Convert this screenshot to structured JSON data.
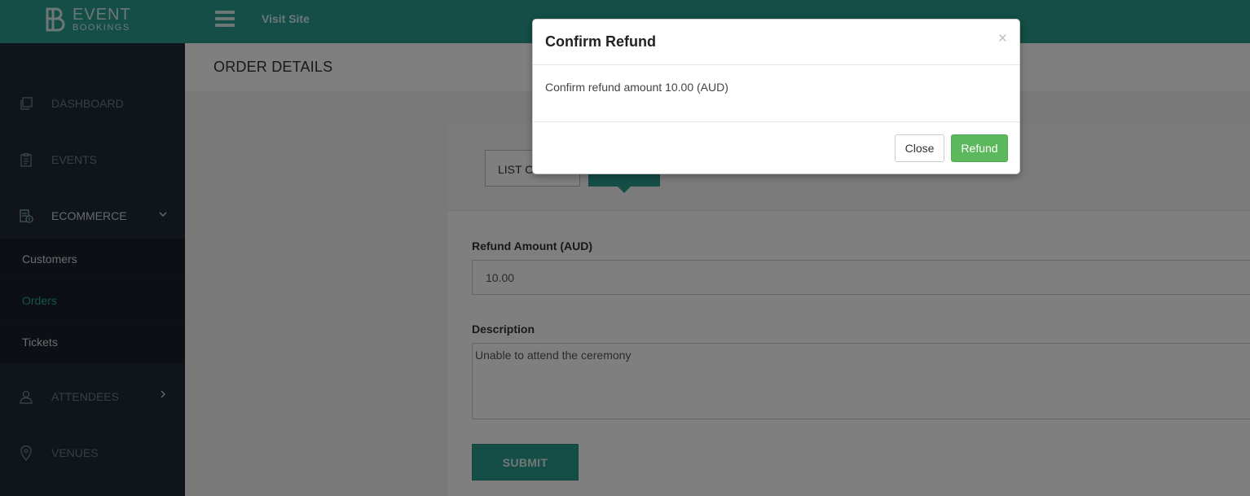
{
  "brand": {
    "line1": "EVENT",
    "line2": "BOOKINGS"
  },
  "topbar": {
    "visit_site": "Visit Site"
  },
  "sidebar": {
    "items": [
      {
        "label": "DASHBOARD",
        "icon": "copy-icon"
      },
      {
        "label": "EVENTS",
        "icon": "clipboard-icon"
      },
      {
        "label": "ECOMMERCE",
        "icon": "cash-register-icon"
      },
      {
        "label": "ATTENDEES",
        "icon": "user-icon"
      },
      {
        "label": "VENUES",
        "icon": "map-pin-icon"
      }
    ],
    "ecommerce_sub": [
      {
        "label": "Customers"
      },
      {
        "label": "Orders"
      },
      {
        "label": "Tickets"
      }
    ]
  },
  "page": {
    "title": "ORDER DETAILS"
  },
  "panel": {
    "list_button": "LIST ORDERS",
    "refund_amount_label": "Refund Amount (AUD)",
    "refund_amount_value": "10.00",
    "description_label": "Description",
    "description_value": "Unable to attend the ceremony",
    "submit_label": "SUBMIT"
  },
  "modal": {
    "title": "Confirm Refund",
    "close_x": "×",
    "body": "Confirm refund amount 10.00 (AUD)",
    "close_label": "Close",
    "refund_label": "Refund"
  },
  "colors": {
    "brand_teal": "#2a9a8e",
    "sidebar_bg": "#202a36",
    "refund_green": "#5cb85c"
  }
}
